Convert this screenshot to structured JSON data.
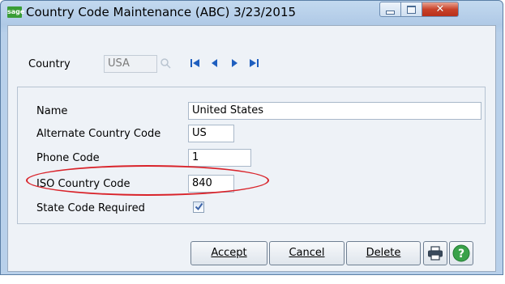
{
  "window": {
    "title": "Country Code Maintenance (ABC) 3/23/2015",
    "app_icon_text": "sage",
    "controls": [
      "minimize",
      "maximize",
      "close"
    ]
  },
  "country": {
    "label": "Country",
    "value": "USA",
    "nav_icons": [
      "first-record-icon",
      "previous-record-icon",
      "next-record-icon",
      "last-record-icon"
    ]
  },
  "form": {
    "name": {
      "label": "Name",
      "value": "United States"
    },
    "alternate_code": {
      "label": "Alternate Country Code",
      "value": "US"
    },
    "phone_code": {
      "label": "Phone Code",
      "value": "1"
    },
    "iso_code": {
      "label": "ISO Country Code",
      "value": "840"
    },
    "state_required": {
      "label": "State Code Required",
      "checked": true
    }
  },
  "buttons": {
    "accept": "Accept",
    "cancel": "Cancel",
    "delete": "Delete",
    "print_icon": "printer-icon",
    "help_icon": "help-icon"
  },
  "colors": {
    "highlight": "#d9232a",
    "nav_blue": "#1f5fbf",
    "help_green": "#3aa24a",
    "app_icon_green": "#3a9d36"
  }
}
